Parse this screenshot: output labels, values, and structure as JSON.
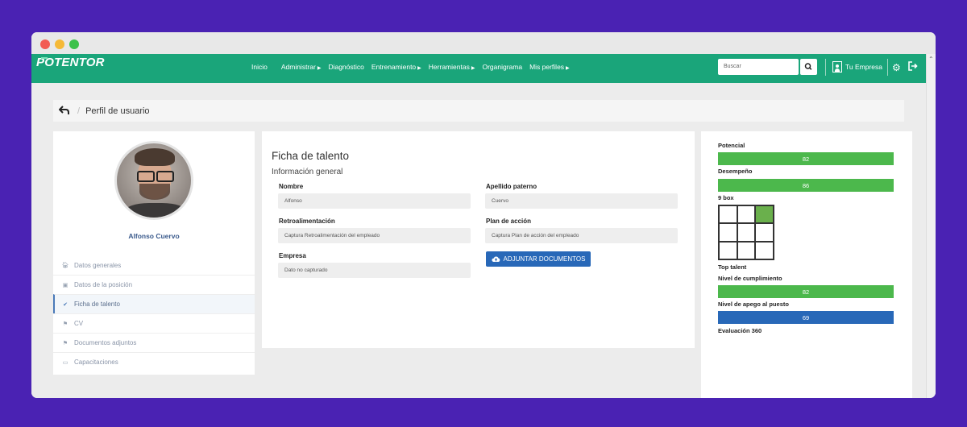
{
  "navbar": {
    "logo": "POTENTOR",
    "links": [
      {
        "label": "Inicio",
        "caret": false
      },
      {
        "label": "Administrar",
        "caret": true
      },
      {
        "label": "Diagnóstico",
        "caret": false
      },
      {
        "label": "Entrenamiento",
        "caret": true
      },
      {
        "label": "Herramientas",
        "caret": true
      },
      {
        "label": "Organigrama",
        "caret": false
      },
      {
        "label": "Mis perfiles",
        "caret": true
      }
    ],
    "search_placeholder": "Buscar",
    "company": "Tu Empresa"
  },
  "breadcrumb": {
    "title": "Perfil de usuario"
  },
  "profile": {
    "name": "Alfonso Cuervo",
    "menu": [
      {
        "label": "Datos generales",
        "icon": "home-icon",
        "active": false
      },
      {
        "label": "Datos de la posición",
        "icon": "briefcase-icon",
        "active": false
      },
      {
        "label": "Ficha de talento",
        "icon": "check-icon",
        "active": true
      },
      {
        "label": "CV",
        "icon": "flag-icon",
        "active": false
      },
      {
        "label": "Documentos adjuntos",
        "icon": "flag-icon",
        "active": false
      },
      {
        "label": "Capacitaciones",
        "icon": "laptop-icon",
        "active": false
      }
    ]
  },
  "talent": {
    "title": "Ficha de talento",
    "subtitle": "Información general",
    "fields": {
      "nombre_label": "Nombre",
      "nombre_value": "Alfonso",
      "apellido_label": "Apellido paterno",
      "apellido_value": "Cuervo",
      "retro_label": "Retroalimentación",
      "retro_placeholder": "Captura Retroalimentación del empleado",
      "plan_label": "Plan de acción",
      "plan_placeholder": "Captura Plan de acción del empleado",
      "empresa_label": "Empresa",
      "empresa_value": "Dato no capturado"
    },
    "attach_button": "ADJUNTAR DOCUMENTOS"
  },
  "metrics": {
    "potencial_label": "Potencial",
    "potencial_value": "82",
    "potencial": 82,
    "desempeno_label": "Desempeño",
    "desempeno_value": "86",
    "desempeno": 86,
    "ninebox_label": "9 box",
    "ninebox_highlight": {
      "row": 0,
      "col": 2
    },
    "top_talent_label": "Top talent",
    "cumplimiento_label": "Nivel de cumplimiento",
    "cumplimiento_value": "82",
    "cumplimiento": 82,
    "apego_label": "Nivel de apego al puesto",
    "apego_value": "69",
    "apego": 69,
    "eval360_label": "Evaluación 360",
    "colors": {
      "green": "#4cb84c",
      "blue": "#2868b8",
      "highlight": "#6ab04c"
    }
  }
}
